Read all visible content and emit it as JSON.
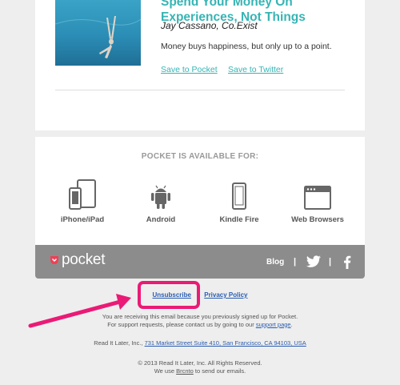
{
  "article": {
    "title_line1": "Spend Your Money On",
    "title_line2": "Experiences, Not Things",
    "author": "Jay Cassano, Co.Exist",
    "summary": "Money buys happiness, but only up to a point.",
    "save_pocket": "Save to Pocket",
    "save_twitter": "Save to Twitter"
  },
  "platforms": {
    "heading": "POCKET IS AVAILABLE FOR:",
    "items": [
      {
        "label": "iPhone/iPad",
        "icon": "iphone-ipad-icon"
      },
      {
        "label": "Android",
        "icon": "android-icon"
      },
      {
        "label": "Kindle Fire",
        "icon": "kindle-fire-icon"
      },
      {
        "label": "Web Browsers",
        "icon": "web-browser-icon"
      }
    ]
  },
  "footer": {
    "brand": "pocket",
    "blog": "Blog",
    "sep": "|",
    "twitter_icon": "twitter-icon",
    "facebook_icon": "facebook-icon"
  },
  "legal": {
    "unsubscribe": "Unsubscribe",
    "bar": "|",
    "privacy": "Privacy Policy",
    "notice1": "You are receiving this email because you previously signed up for Pocket.",
    "notice2_pre": "For support requests, please contact us by going to our ",
    "support_link": "support page",
    "notice2_post": ".",
    "company": "Read It Later, Inc., ",
    "address": "731 Market Street Suite 410, San Francisco, CA 94103, USA",
    "copyright": "© 2013 Read It Later, Inc. All Rights Reserved.",
    "brcnto_pre": "We use ",
    "brcnto": "Brcnto",
    "brcnto_post": " to send our emails."
  },
  "colors": {
    "accent": "#37b4b4",
    "annotation": "#ea1a76",
    "footer_bar": "#8c8c8c",
    "brand_heart": "#ee4056"
  }
}
